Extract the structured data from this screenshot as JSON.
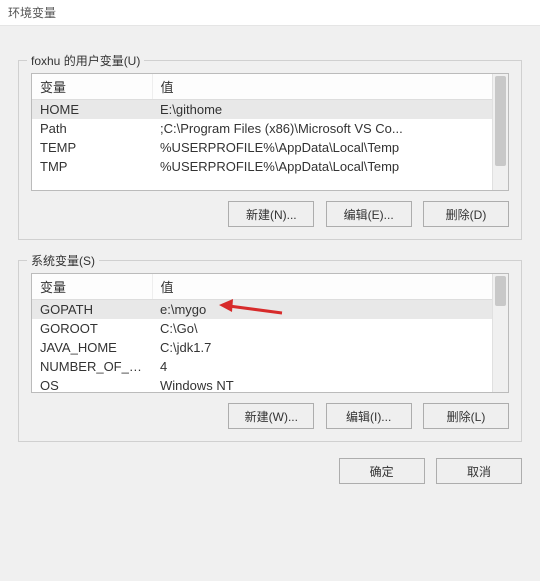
{
  "window": {
    "title": "环境变量"
  },
  "user_vars": {
    "label": "foxhu 的用户变量(U)",
    "headers": {
      "name": "变量",
      "value": "值"
    },
    "rows": [
      {
        "name": "HOME",
        "value": "E:\\githome"
      },
      {
        "name": "Path",
        "value": ";C:\\Program Files (x86)\\Microsoft VS Co..."
      },
      {
        "name": "TEMP",
        "value": "%USERPROFILE%\\AppData\\Local\\Temp"
      },
      {
        "name": "TMP",
        "value": "%USERPROFILE%\\AppData\\Local\\Temp"
      }
    ],
    "selected_index": 0,
    "buttons": {
      "new": "新建(N)...",
      "edit": "编辑(E)...",
      "delete": "删除(D)"
    }
  },
  "system_vars": {
    "label": "系统变量(S)",
    "headers": {
      "name": "变量",
      "value": "值"
    },
    "rows": [
      {
        "name": "GOPATH",
        "value": "e:\\mygo"
      },
      {
        "name": "GOROOT",
        "value": "C:\\Go\\"
      },
      {
        "name": "JAVA_HOME",
        "value": "C:\\jdk1.7"
      },
      {
        "name": "NUMBER_OF_PR...",
        "value": "4"
      },
      {
        "name": "OS",
        "value": "Windows NT"
      }
    ],
    "selected_index": 0,
    "buttons": {
      "new": "新建(W)...",
      "edit": "编辑(I)...",
      "delete": "删除(L)"
    }
  },
  "dialog_buttons": {
    "ok": "确定",
    "cancel": "取消"
  },
  "annotation": {
    "arrow_color": "#d72b2b"
  }
}
